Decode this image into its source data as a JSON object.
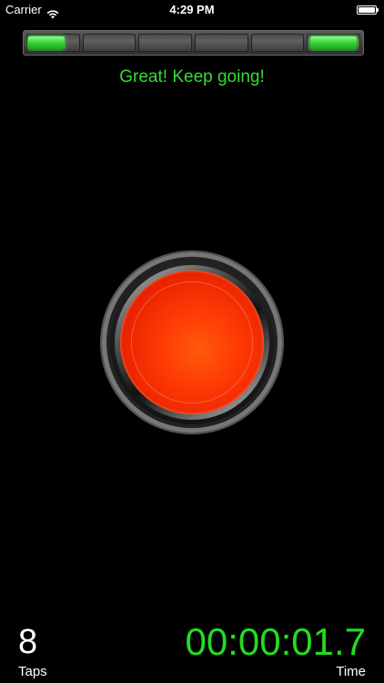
{
  "status_bar": {
    "carrier": "Carrier",
    "time": "4:29 PM",
    "wifi_icon": "wifi-icon",
    "battery_icon": "battery-icon"
  },
  "progress": {
    "segments_total": 6,
    "segments": [
      "lit-partial",
      "off",
      "off",
      "off",
      "off",
      "lit"
    ],
    "accent_color": "#3fd43f"
  },
  "message": "Great! Keep going!",
  "tap_button": {
    "color": "#ff3a05"
  },
  "stats": {
    "taps_value": "8",
    "taps_label": "Taps",
    "time_value": "00:00:01.7",
    "time_label": "Time",
    "time_color": "#22dd22"
  }
}
